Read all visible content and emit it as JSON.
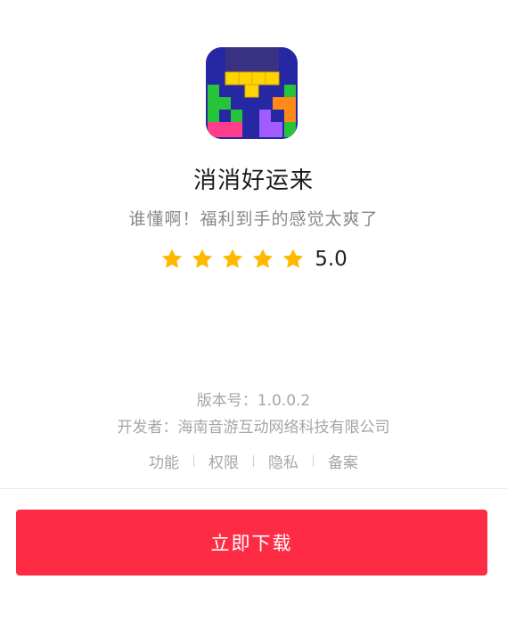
{
  "app": {
    "icon": "tetris-blocks-app-icon",
    "name": "消消好运来",
    "slogan": "谁懂啊！福利到手的感觉太爽了",
    "rating": {
      "stars": 5,
      "value": "5.0",
      "star_color": "#ffb800"
    }
  },
  "meta": {
    "version": "版本号：1.0.0.2",
    "developer": "开发者：海南音游互动网络科技有限公司"
  },
  "links": [
    {
      "label": "功能"
    },
    {
      "label": "权限"
    },
    {
      "label": "隐私"
    },
    {
      "label": "备案"
    }
  ],
  "cta": {
    "label": "立即下载",
    "color": "#fe2b45"
  }
}
